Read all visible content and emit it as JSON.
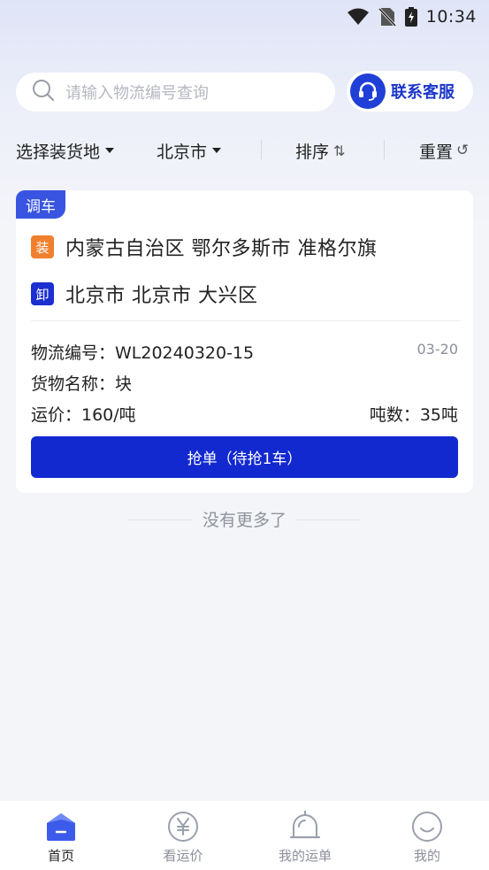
{
  "status_bar": {
    "time": "10:34"
  },
  "search": {
    "placeholder": "请输入物流编号查询"
  },
  "service_button": {
    "label": "联系客服"
  },
  "filters": {
    "location_label": "选择装货地",
    "city_label": "北京市",
    "sort_label": "排序",
    "sort_glyph": "⇅",
    "reset_label": "重置",
    "reset_glyph": "↺"
  },
  "card": {
    "tag": "调车",
    "load_badge": "装",
    "load_route": "内蒙古自治区  鄂尔多斯市  准格尔旗",
    "unload_badge": "卸",
    "unload_route": "北京市  北京市  大兴区",
    "logistics_no": "物流编号：WL20240320-15",
    "date": "03-20",
    "goods_name": "货物名称：块",
    "freight": "运价：160/吨",
    "tonnage": "吨数：35吨",
    "grab_button": "抢单（待抢1车）"
  },
  "end_text": "没有更多了",
  "tabs": [
    {
      "label": "首页",
      "icon": "home-icon",
      "active": true
    },
    {
      "label": "看运价",
      "icon": "yuan-icon",
      "active": false
    },
    {
      "label": "我的运单",
      "icon": "bell-icon",
      "active": false
    },
    {
      "label": "我的",
      "icon": "smile-icon",
      "active": false
    }
  ],
  "colors": {
    "primary": "#1329d0",
    "accent_tag": "#3854e0",
    "load_badge": "#f0802e",
    "unload_badge": "#1c2fd0"
  }
}
